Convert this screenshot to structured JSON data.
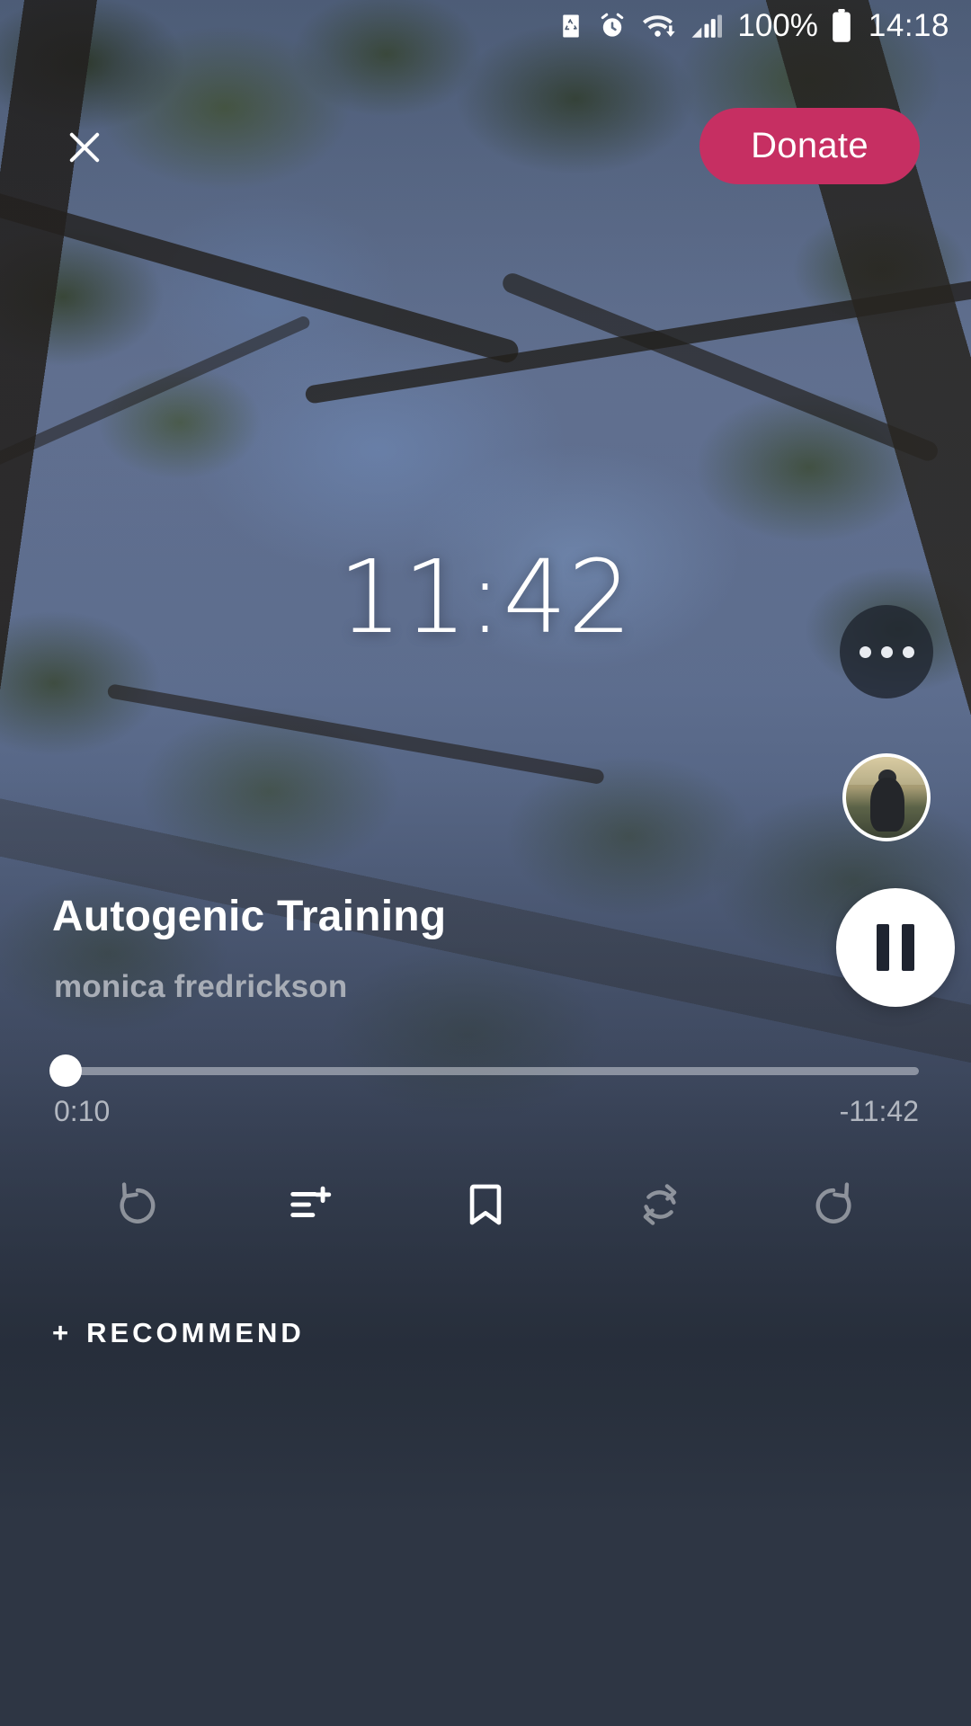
{
  "status_bar": {
    "icons": [
      "recycle-icon",
      "alarm-clock-icon",
      "wifi-download-icon",
      "cellular-signal-icon"
    ],
    "battery_percent": "100%",
    "time": "14:18"
  },
  "header": {
    "close_label": "✕",
    "close_icon": "close-icon",
    "donate_label": "Donate",
    "donate_color": "#c62f62"
  },
  "player": {
    "countdown": "11:42",
    "more_icon": "ellipsis-icon",
    "avatar_icon": "teacher-avatar",
    "play_state_icon": "pause-icon",
    "title": "Autogenic Training",
    "artist": "monica fredrickson",
    "time_elapsed": "0:10",
    "time_remaining": "-11:42",
    "progress_percent": 1.4
  },
  "toolbar": {
    "items": [
      {
        "name": "rewind-icon",
        "label": "Rewind",
        "enabled": false
      },
      {
        "name": "add-to-queue-icon",
        "label": "Add to playlist",
        "enabled": true
      },
      {
        "name": "bookmark-icon",
        "label": "Bookmark",
        "enabled": true
      },
      {
        "name": "repeat-icon",
        "label": "Repeat",
        "enabled": false
      },
      {
        "name": "forward-icon",
        "label": "Forward",
        "enabled": false
      }
    ]
  },
  "footer": {
    "recommend_plus": "+",
    "recommend_label": "RECOMMEND"
  }
}
